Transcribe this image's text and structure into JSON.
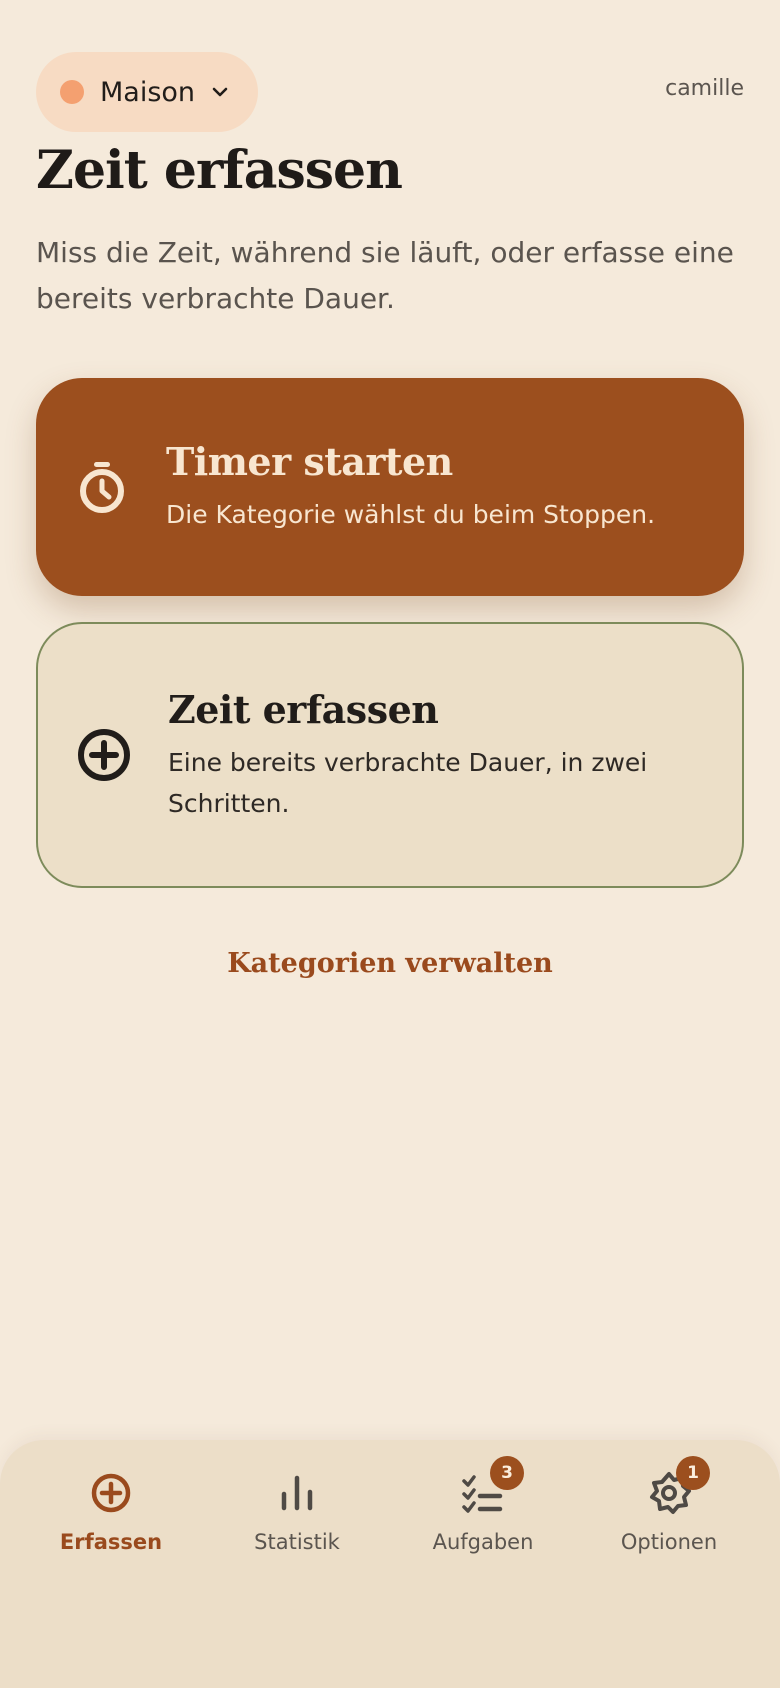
{
  "header": {
    "space_name": "Maison",
    "username": "camille",
    "space_color": "#f4a070"
  },
  "page": {
    "title": "Zeit erfassen",
    "intro": "Miss die Zeit, während sie läuft, oder erfasse eine bereits verbrachte Dauer."
  },
  "cards": {
    "timer": {
      "title": "Timer starten",
      "subtitle": "Die Kategorie wählst du beim Stoppen.",
      "icon": "stopwatch-icon",
      "color": "#9c4f1e"
    },
    "manual": {
      "title": "Zeit erfassen",
      "subtitle": "Eine bereits verbrachte Dauer, in zwei Schritten.",
      "icon": "plus-circle-icon"
    }
  },
  "manage_link": "Kategorien verwalten",
  "nav": {
    "items": [
      {
        "label": "Erfassen",
        "icon": "plus-circle-icon",
        "active": true
      },
      {
        "label": "Statistik",
        "icon": "bar-chart-icon"
      },
      {
        "label": "Aufgaben",
        "icon": "checklist-icon",
        "badge": "3"
      },
      {
        "label": "Optionen",
        "icon": "gear-icon",
        "badge": "1"
      }
    ]
  }
}
